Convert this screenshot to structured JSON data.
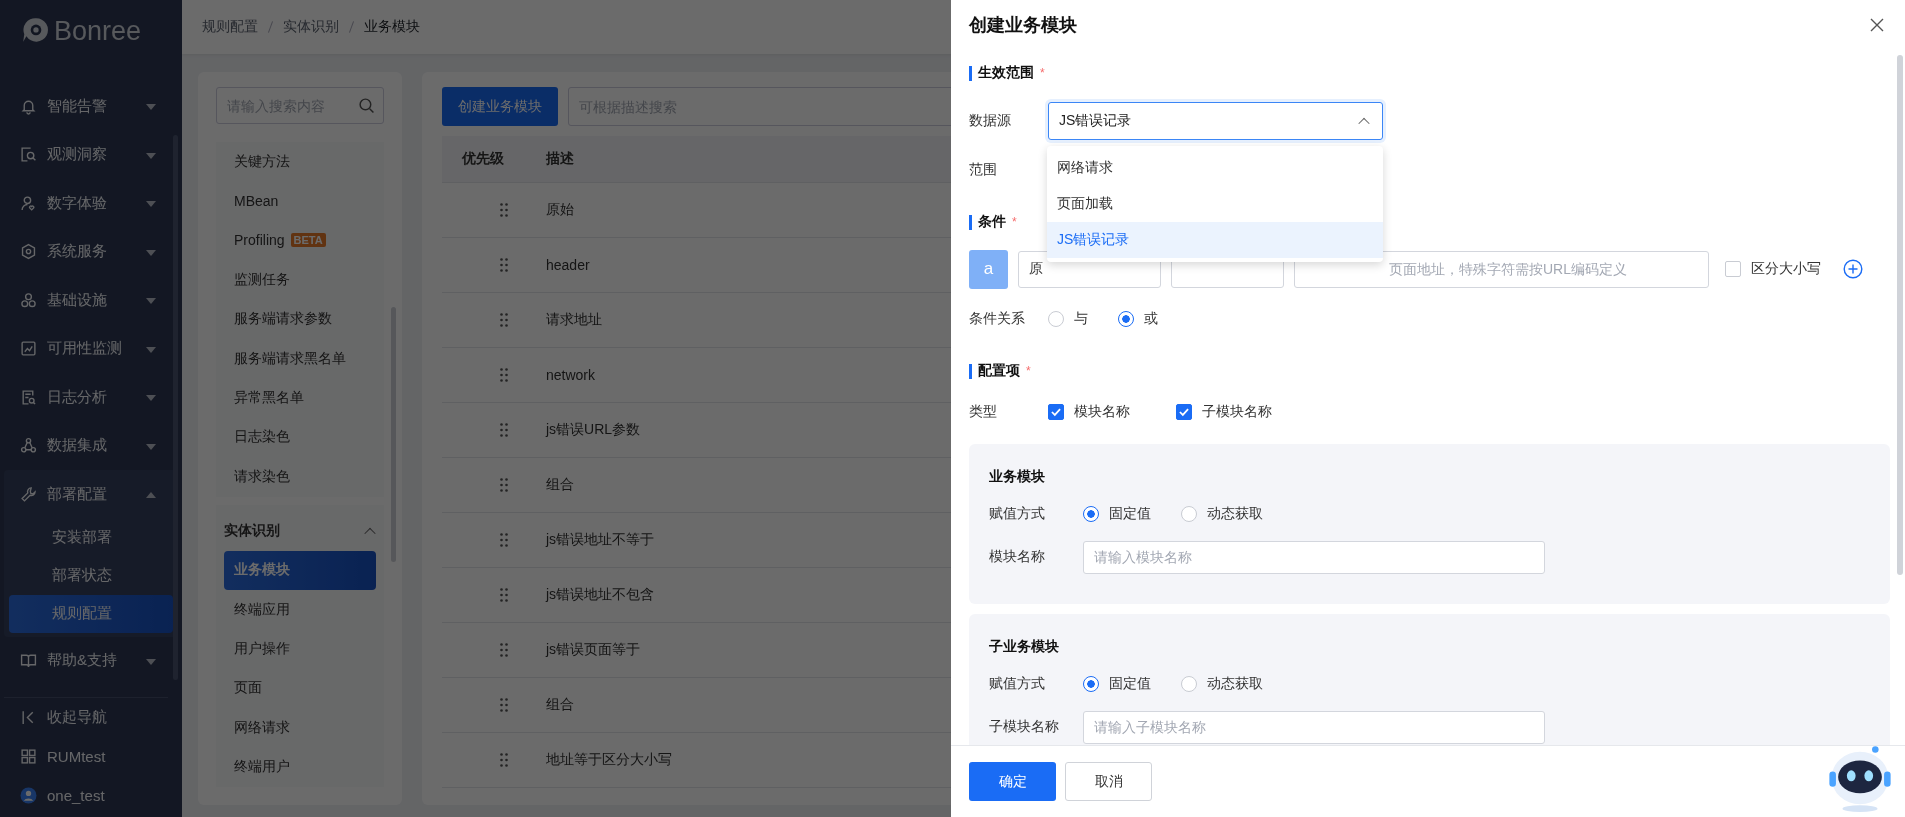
{
  "sidebar": {
    "logo": "Bonree",
    "items": [
      {
        "label": "智能告警",
        "kind": "bell",
        "expanded": false
      },
      {
        "label": "观测洞察",
        "kind": "inspect",
        "expanded": false
      },
      {
        "label": "数字体验",
        "kind": "user",
        "expanded": false
      },
      {
        "label": "系统服务",
        "kind": "hub",
        "expanded": false
      },
      {
        "label": "基础设施",
        "kind": "cubes",
        "expanded": false
      },
      {
        "label": "可用性监测",
        "kind": "chart",
        "expanded": false
      },
      {
        "label": "日志分析",
        "kind": "log",
        "expanded": false
      },
      {
        "label": "数据集成",
        "kind": "share",
        "expanded": false
      },
      {
        "label": "部署配置",
        "kind": "wrench",
        "expanded": true,
        "children": [
          {
            "label": "安装部署",
            "selected": false
          },
          {
            "label": "部署状态",
            "selected": false
          },
          {
            "label": "规则配置",
            "selected": true
          }
        ]
      },
      {
        "label": "帮助&支持",
        "kind": "book",
        "expanded": false
      }
    ],
    "footer": [
      {
        "label": "收起导航",
        "kind": "collapse"
      },
      {
        "label": "RUMtest",
        "kind": "apps"
      },
      {
        "label": "one_test",
        "kind": "avatar"
      }
    ]
  },
  "breadcrumb": [
    "规则配置",
    "实体识别",
    "业务模块"
  ],
  "rule_menu": {
    "search_placeholder": "请输入搜索内容",
    "items": [
      {
        "label": "关键方法",
        "selected": false
      },
      {
        "label": "MBean",
        "selected": false
      },
      {
        "label": "Profiling",
        "badge": "BETA",
        "selected": false
      },
      {
        "label": "监测任务",
        "selected": false
      },
      {
        "label": "服务端请求参数",
        "selected": false
      },
      {
        "label": "服务端请求黑名单",
        "selected": false
      },
      {
        "label": "异常黑名单",
        "selected": false
      },
      {
        "label": "日志染色",
        "selected": false
      },
      {
        "label": "请求染色",
        "selected": false
      }
    ],
    "group": {
      "label": "实体识别",
      "expanded": true,
      "items": [
        {
          "label": "业务模块",
          "selected": true
        },
        {
          "label": "终端应用",
          "selected": false
        },
        {
          "label": "用户操作",
          "selected": false
        },
        {
          "label": "页面",
          "selected": false
        },
        {
          "label": "网络请求",
          "selected": false
        },
        {
          "label": "终端用户",
          "selected": false
        }
      ]
    }
  },
  "table": {
    "create_button": "创建业务模块",
    "search_placeholder": "可根据描述搜索",
    "columns": [
      "优先级",
      "描述"
    ],
    "rows": [
      {
        "description": "原始"
      },
      {
        "description": "header"
      },
      {
        "description": "请求地址"
      },
      {
        "description": "network"
      },
      {
        "description": "js错误URL参数"
      },
      {
        "description": "组合"
      },
      {
        "description": "js错误地址不等于"
      },
      {
        "description": "js错误地址不包含"
      },
      {
        "description": "js错误页面等于"
      },
      {
        "description": "组合"
      },
      {
        "description": "地址等于区分大小写"
      }
    ]
  },
  "drawer": {
    "title": "创建业务模块",
    "scope": {
      "heading": "生效范围",
      "mark": "*",
      "data_source": {
        "label": "数据源",
        "value": "JS错误记录",
        "open": true,
        "options": [
          {
            "label": "网络请求",
            "selected": false
          },
          {
            "label": "页面加载",
            "selected": false
          },
          {
            "label": "JS错误记录",
            "selected": true
          }
        ]
      },
      "range": {
        "label": "范围"
      }
    },
    "conditions": {
      "heading": "条件",
      "mark": "*",
      "rows": [
        {
          "tag": "a",
          "field": "原",
          "placeholder": "页面地址，特殊字符需按URL编码定义",
          "case_sensitive": {
            "label": "区分大小写",
            "checked": false
          }
        }
      ],
      "relation": {
        "label": "条件关系",
        "options": [
          {
            "label": "与",
            "selected": false
          },
          {
            "label": "或",
            "selected": true
          }
        ]
      }
    },
    "config": {
      "heading": "配置项",
      "mark": "*",
      "type": {
        "label": "类型",
        "options": [
          {
            "label": "模块名称",
            "checked": true
          },
          {
            "label": "子模块名称",
            "checked": true
          }
        ]
      },
      "cards": [
        {
          "title": "业务模块",
          "assign": {
            "label": "赋值方式",
            "options": [
              {
                "label": "固定值",
                "selected": true
              },
              {
                "label": "动态获取",
                "selected": false
              }
            ]
          },
          "name": {
            "label": "模块名称",
            "placeholder": "请输入模块名称"
          }
        },
        {
          "title": "子业务模块",
          "assign": {
            "label": "赋值方式",
            "options": [
              {
                "label": "固定值",
                "selected": true
              },
              {
                "label": "动态获取",
                "selected": false
              }
            ]
          },
          "name": {
            "label": "子模块名称",
            "placeholder": "请输入子模块名称"
          }
        }
      ]
    },
    "footer": {
      "confirm": "确定",
      "cancel": "取消"
    }
  }
}
